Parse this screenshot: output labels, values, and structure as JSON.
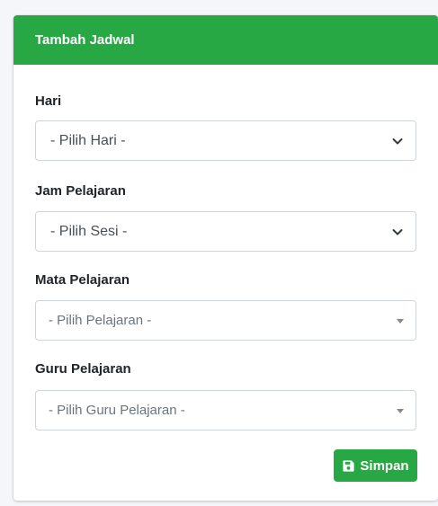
{
  "card": {
    "title": "Tambah Jadwal",
    "fields": [
      {
        "label": "Hari",
        "value": "- Pilih Hari -"
      },
      {
        "label": "Jam Pelajaran",
        "value": "- Pilih Sesi -"
      },
      {
        "label": "Mata Pelajaran",
        "value": "- Pilih Pelajaran -"
      },
      {
        "label": "Guru Pelajaran",
        "value": "- Pilih Guru Pelajaran -"
      }
    ],
    "save_button": {
      "label": "Simpan",
      "icon": "save-icon"
    }
  },
  "colors": {
    "accent": "#28a745",
    "border": "#ced4da",
    "background": "#f4f6f9"
  }
}
